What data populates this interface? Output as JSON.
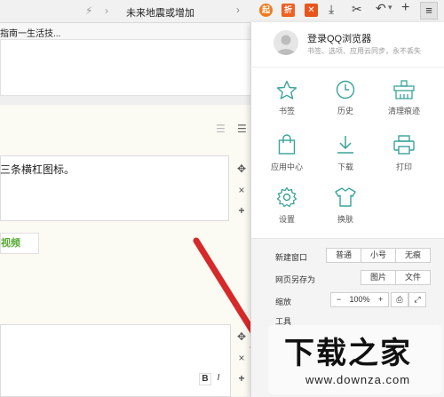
{
  "topbar": {
    "tab_fragment": "指南一生活技...",
    "address_text": "未来地震或增加"
  },
  "editor": {
    "text": "三条横杠图标。",
    "video_button": "视频",
    "format_bold": "B",
    "format_italic": "I"
  },
  "menu": {
    "login_title": "登录QQ浏览器",
    "login_subtitle": "书签、选项、应用云同步，永不丢失",
    "grid": [
      {
        "label": "书签",
        "icon": "star-icon"
      },
      {
        "label": "历史",
        "icon": "clock-icon"
      },
      {
        "label": "清理痕迹",
        "icon": "broom-icon"
      },
      {
        "label": "应用中心",
        "icon": "bag-icon"
      },
      {
        "label": "下载",
        "icon": "download-icon"
      },
      {
        "label": "打印",
        "icon": "printer-icon"
      },
      {
        "label": "设置",
        "icon": "gear-icon"
      },
      {
        "label": "换肤",
        "icon": "shirt-icon"
      }
    ],
    "new_window_label": "新建窗口",
    "new_window_options": [
      "普通",
      "小号",
      "无痕"
    ],
    "save_as_label": "网页另存为",
    "save_as_options": [
      "图片",
      "文件"
    ],
    "zoom_label": "缩放",
    "zoom_minus": "−",
    "zoom_value": "100%",
    "zoom_plus": "+",
    "tools_label": "工具"
  },
  "watermark": {
    "title": "下载之家",
    "url": "www.downza.com"
  },
  "colors": {
    "accent": "#3aa39a",
    "arrow": "#d62a2a",
    "video_green": "#5cab38"
  }
}
